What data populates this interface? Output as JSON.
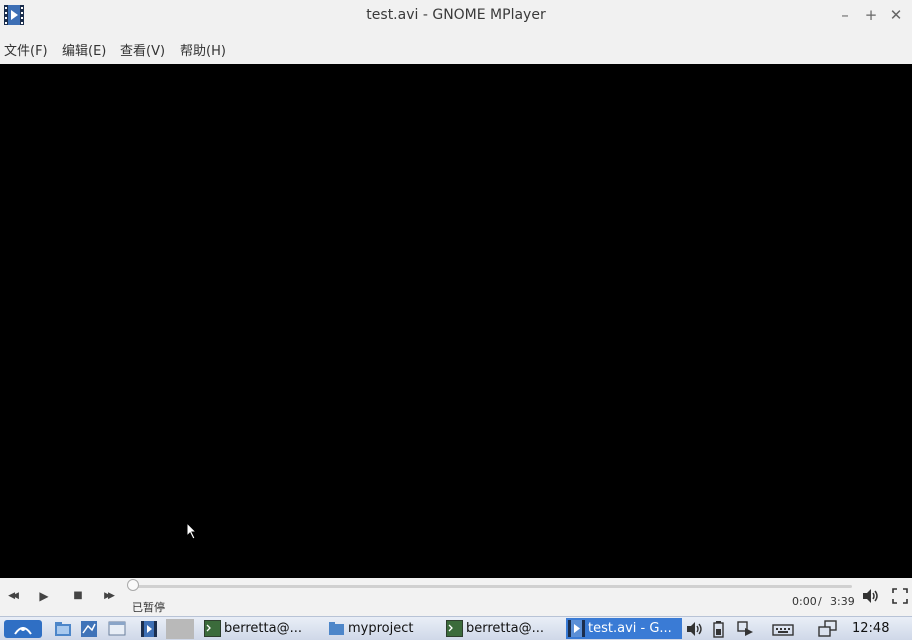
{
  "window": {
    "title": "test.avi - GNOME MPlayer",
    "min_glyph": "–",
    "max_glyph": "+",
    "close_glyph": "✕"
  },
  "menu": [
    "文件(F)",
    "编辑(E)",
    "查看(V)",
    "帮助(H)"
  ],
  "player": {
    "status": "已暂停",
    "time_current": "0:00",
    "time_separator": "/",
    "time_total": "3:39",
    "progress": 0,
    "buttons": {
      "rewind": "◀◀",
      "play": "▶",
      "stop": "■",
      "forward": "▶▶"
    }
  },
  "taskbar": {
    "tasks": [
      {
        "label": "berretta@..."
      },
      {
        "label": "myproject"
      },
      {
        "label": "berretta@..."
      },
      {
        "label": "test.avi - G..."
      }
    ],
    "clock": "12:48"
  },
  "colors": {
    "video_bg": "#000000",
    "active_task": "#3a7bd5",
    "taskbar_bg": "#dbe2ee"
  }
}
